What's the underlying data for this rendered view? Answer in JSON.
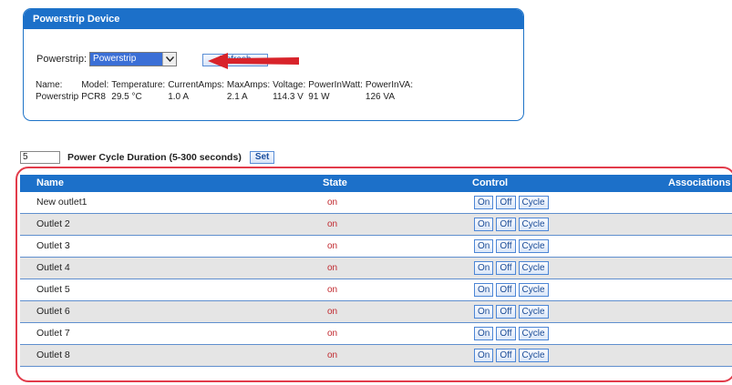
{
  "device_panel": {
    "title": "Powerstrip Device",
    "powerstrip_label": "Powerstrip:",
    "powerstrip_selected": "Powerstrip",
    "refresh_label": "Refresh",
    "info_headers": [
      "Name:",
      "Model:",
      "Temperature:",
      "CurrentAmps:",
      "MaxAmps:",
      "Voltage:",
      "PowerInWatt:",
      "PowerInVA:"
    ],
    "info_values": [
      "Powerstrip",
      "PCR8",
      "29.5 °C",
      "1.0 A",
      "2.1 A",
      "114.3 V",
      "91 W",
      "126 VA"
    ]
  },
  "duration": {
    "value": "5",
    "label": "Power Cycle Duration (5-300 seconds)",
    "set_label": "Set"
  },
  "outlets_table": {
    "headers": {
      "name": "Name",
      "state": "State",
      "control": "Control",
      "associations": "Associations"
    },
    "control_labels": {
      "on": "On",
      "off": "Off",
      "cycle": "Cycle"
    },
    "rows": [
      {
        "name": "New outlet1",
        "state": "on"
      },
      {
        "name": "Outlet 2",
        "state": "on"
      },
      {
        "name": "Outlet 3",
        "state": "on"
      },
      {
        "name": "Outlet 4",
        "state": "on"
      },
      {
        "name": "Outlet 5",
        "state": "on"
      },
      {
        "name": "Outlet 6",
        "state": "on"
      },
      {
        "name": "Outlet 7",
        "state": "on"
      },
      {
        "name": "Outlet 8",
        "state": "on"
      }
    ]
  },
  "colors": {
    "header_blue": "#1c70c9",
    "state_red": "#c0272d",
    "annotation_red": "#e23b4a"
  }
}
